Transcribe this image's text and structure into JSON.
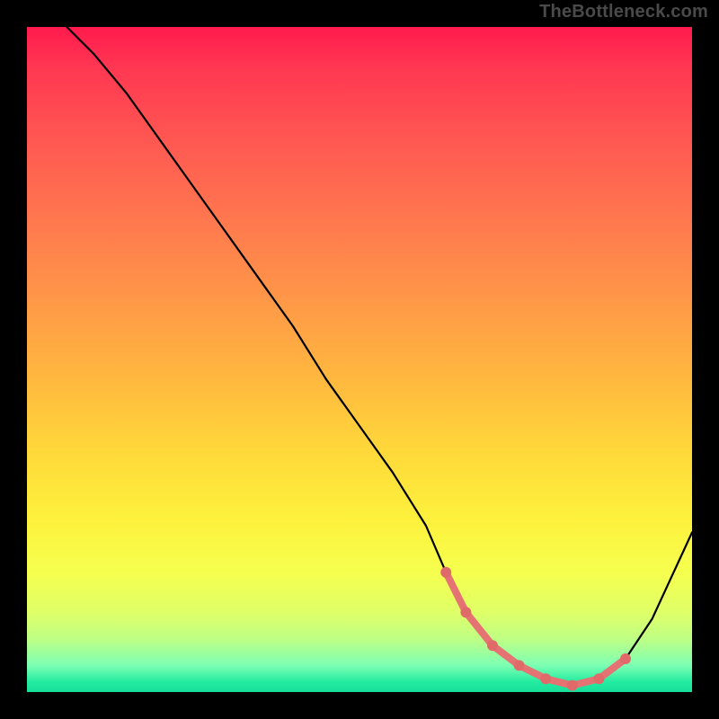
{
  "watermark": "TheBottleneck.com",
  "chart_data": {
    "type": "line",
    "title": "",
    "xlabel": "",
    "ylabel": "",
    "xlim": [
      0,
      100
    ],
    "ylim": [
      0,
      100
    ],
    "grid": false,
    "legend": false,
    "series": [
      {
        "name": "bottleneck-curve",
        "x": [
          6,
          10,
          15,
          20,
          25,
          30,
          35,
          40,
          45,
          50,
          55,
          60,
          63,
          66,
          70,
          74,
          78,
          82,
          86,
          90,
          94,
          100
        ],
        "y": [
          100,
          96,
          90,
          83,
          76,
          69,
          62,
          55,
          47,
          40,
          33,
          25,
          18,
          12,
          7,
          4,
          2,
          1,
          2,
          5,
          11,
          24
        ]
      }
    ],
    "highlight_range": {
      "name": "optimal-zone",
      "x": [
        63,
        66,
        70,
        74,
        78,
        82,
        86,
        90
      ],
      "y": [
        18,
        12,
        7,
        4,
        2,
        1,
        2,
        5
      ]
    },
    "highlight_dots": {
      "x": [
        63,
        66,
        70,
        74,
        78,
        82,
        86,
        90
      ],
      "y": [
        18,
        12,
        7,
        4,
        2,
        1,
        2,
        5
      ]
    }
  }
}
